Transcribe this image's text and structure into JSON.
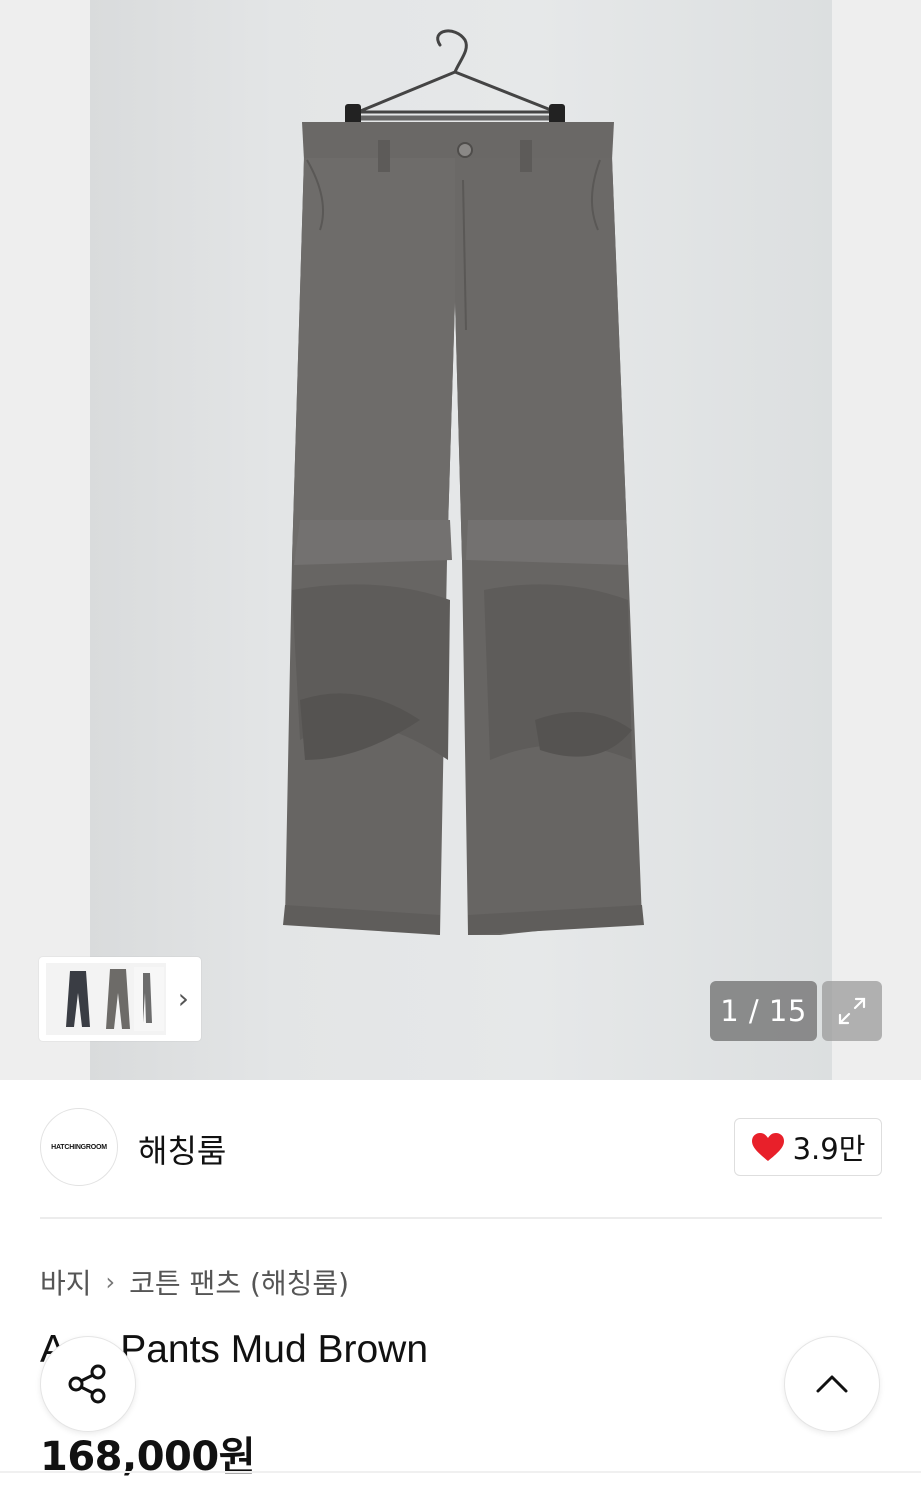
{
  "gallery": {
    "counter": "1 / 15",
    "photo_alt": "pants-on-hanger",
    "thumbnail_strip_icon": "chevron-right-icon",
    "expand_icon": "expand-icon"
  },
  "brand": {
    "logo_text": "HATCHINGROOM",
    "name": "해칭룸",
    "likes": "3.9만",
    "like_color": "#e8202a"
  },
  "breadcrumb": {
    "category": "바지",
    "subcategory": "코튼 팬츠 (해칭룸)"
  },
  "product": {
    "title": "A     or Pants Mud Brown",
    "price": "168,000원"
  },
  "floating": {
    "share_icon": "share-icon",
    "top_icon": "chevron-up-icon"
  }
}
